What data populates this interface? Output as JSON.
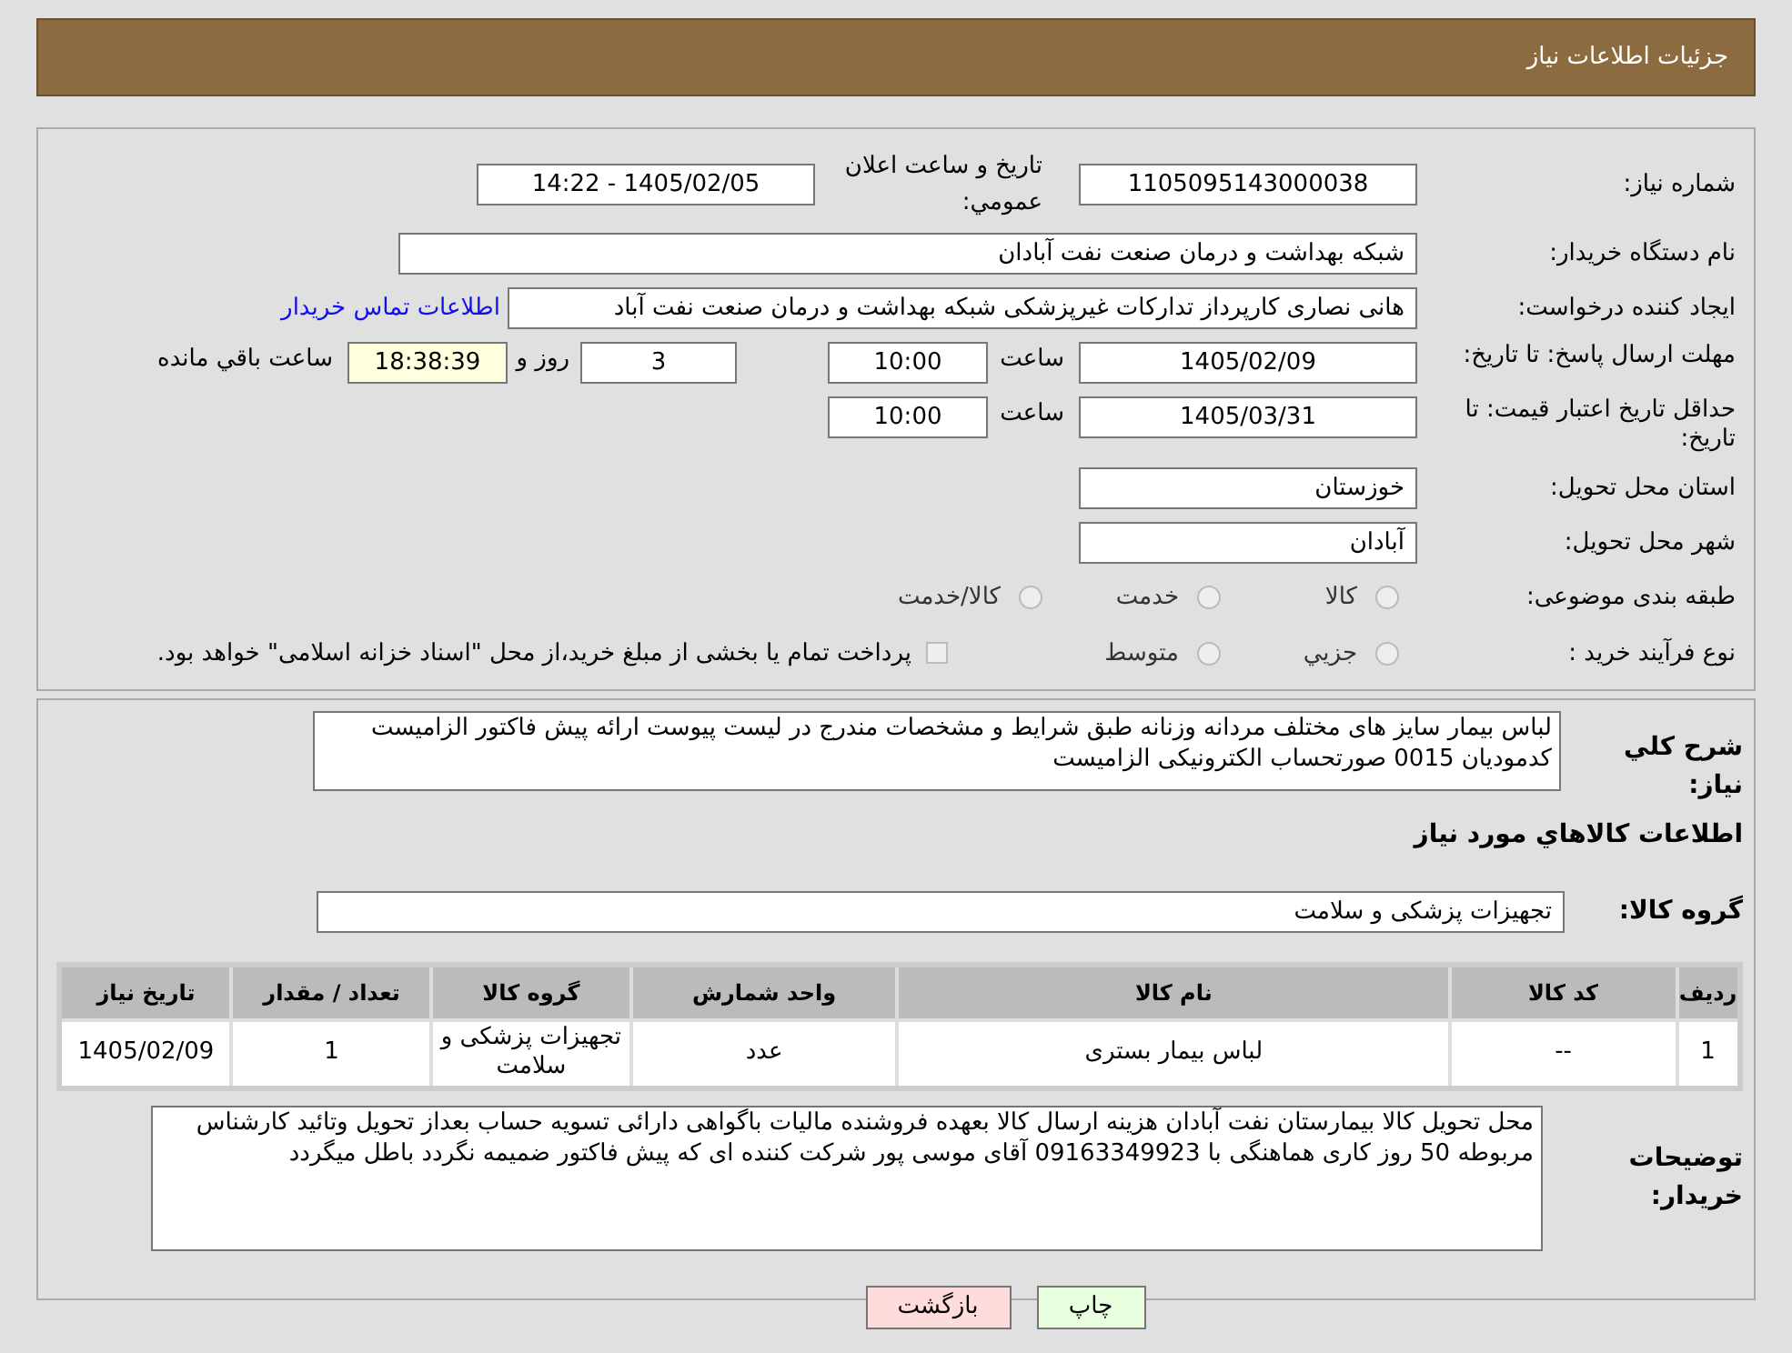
{
  "header": {
    "title": "جزئیات اطلاعات نیاز"
  },
  "need_number": {
    "label": "شماره نیاز:",
    "value": "1105095143000038"
  },
  "announce": {
    "label": "تاریخ و ساعت اعلان عمومي:",
    "value": "1405/02/05 - 14:22"
  },
  "buyer": {
    "label": "نام دستگاه خریدار:",
    "value": "شبکه بهداشت و درمان صنعت نفت آبادان"
  },
  "requester": {
    "label": "ایجاد کننده درخواست:",
    "value": "هانی نصاری کارپرداز تدارکات غیرپزشکی شبکه بهداشت و درمان صنعت نفت آباد",
    "link": "اطلاعات تماس خریدار"
  },
  "reply_deadline": {
    "label": "مهلت ارسال پاسخ: تا تاریخ:",
    "date": "1405/02/09",
    "time_label": "ساعت",
    "time": "10:00",
    "days": "3",
    "days_label": "روز و",
    "remaining": "18:38:39",
    "remaining_label": "ساعت باقي مانده"
  },
  "price_validity": {
    "label": "حداقل تاریخ اعتبار قیمت: تا تاریخ:",
    "date": "1405/03/31",
    "time_label": "ساعت",
    "time": "10:00"
  },
  "province": {
    "label": "استان محل تحویل:",
    "value": "خوزستان"
  },
  "city": {
    "label": "شهر محل تحویل:",
    "value": "آبادان"
  },
  "category": {
    "label": "طبقه بندی موضوعی:",
    "options": [
      {
        "label": "کالا",
        "selected": false
      },
      {
        "label": "خدمت",
        "selected": false
      },
      {
        "label": "کالا/خدمت",
        "selected": false
      }
    ]
  },
  "purchase_type": {
    "label": "نوع فرآیند خرید :",
    "options": [
      {
        "label": "جزيي",
        "selected": false
      },
      {
        "label": "متوسط",
        "selected": false
      }
    ],
    "payment_note": {
      "label": "پرداخت تمام یا بخشی از مبلغ خرید،از محل \"اسناد خزانه اسلامی\" خواهد بود.",
      "checked": false
    }
  },
  "description": {
    "label": "شرح كلي نياز:",
    "value": "لباس بیمار سایز های مختلف مردانه وزنانه طبق شرایط و مشخصات مندرج در لیست پیوست ارائه پیش فاکتور الزامیست  کدمودیان 0015 صورتحساب الکترونیکی الزامیست"
  },
  "items_heading": "اطلاعات كالاهاي مورد نياز",
  "goods_group": {
    "label": "گروه کالا:",
    "value": "تجهیزات پزشکی و سلامت"
  },
  "table": {
    "columns": [
      "رديف",
      "کد کالا",
      "نام کالا",
      "واحد شمارش",
      "گروه کالا",
      "تعداد / مقدار",
      "تاریخ نیاز"
    ],
    "rows": [
      [
        "1",
        "--",
        "لباس بیمار بستری",
        "عدد",
        "تجهیزات پزشکی و سلامت",
        "1",
        "1405/02/09"
      ]
    ]
  },
  "buyer_notes": {
    "label": "توضیحات خریدار:",
    "value": "محل تحویل کالا بیمارستان نفت آبادان هزینه ارسال کالا بعهده فروشنده مالیات باگواهی دارائی تسویه حساب بعداز تحویل وتائید کارشناس مربوطه 50 روز کاری هماهنگی با 09163349923 آقای موسی پور شرکت کننده ای که پیش فاکتور ضمیمه نگردد باطل میگردد"
  },
  "buttons": [
    {
      "label": "چاپ",
      "kind": "print"
    },
    {
      "label": "بازگشت",
      "kind": "back"
    }
  ]
}
